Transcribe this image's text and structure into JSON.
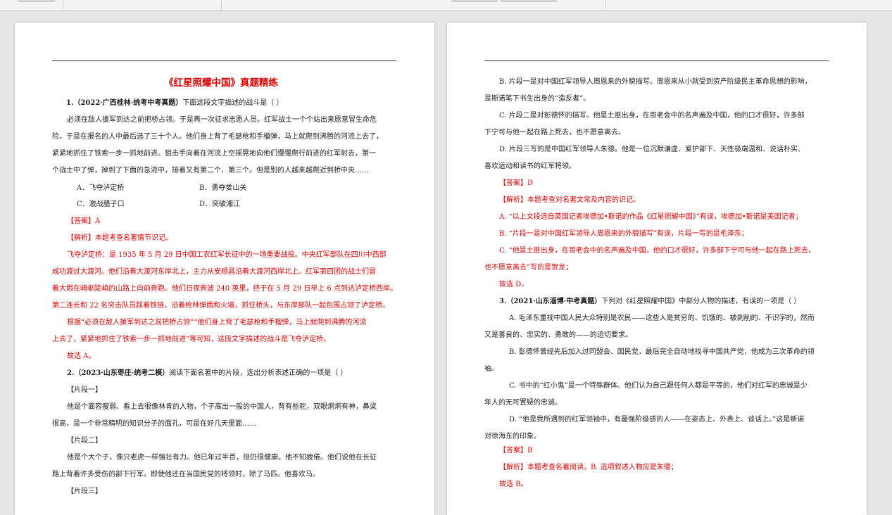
{
  "left_page": {
    "title": "《红星照耀中国》真题精练",
    "q1": {
      "src": "1.（2022·广西桂林·统考中考真题）",
      "stem": "下面这段文字描述的战斗是（        ）",
      "passage": [
        "必须在敌人援军到达之前把桥占领。于是再一次征求志愿人员。红军战士一个个站出来愿意冒生命危",
        "险，于是在报名的人中最后选了三十个人。他们身上背了毛瑟枪和手榴弹，马上就爬到沸腾的河流上去了，",
        "紧紧地抓住了铁索一步一抓地前进。狙击手向着在河流上空摇晃地向他们慢慢爬行前进的红军射去，第一",
        "个战士中了弹，掉到了下面的急流中，接着又有第二个、第三个。但是别的人越来越爬近到桥中央……"
      ],
      "opt_a": "A．飞夺泸定桥",
      "opt_b": "B．勇夺娄山关",
      "opt_c": "C．激战腊子口",
      "opt_d": "D．突破湘江",
      "answer": "【答案】A",
      "analysis": "【解析】本题考查名著情节识记。",
      "detail": [
        "飞夺泸定桥：是 1935 年 5 月 29 日中国工农红军长征中的一场重要战役。中央红军部队在四川中西部",
        "成功渡过大渡河。他们沿着大渡河东岸北上，主力从安顺昌沿着大渡河西岸北上。红军第四团的战士们冒",
        "着大雨在崎岖陡峭的山路上向前奔跑。他们日夜奔波 240 英里，终于在 5 月 29 日早上 6 点到达泸定桥西岸。",
        "第二连长和 22 名突击队员踩着铁链，沿着枪林弹雨和火墙，抓住桥头，与东岸部队一起包围占领了泸定桥。",
        "根据“必须在敌人援军到达之前把桥占领”“他们身上背了毛瑟枪和手榴弹，马上就爬到沸腾的河流",
        "上去了，紧紧地抓住了铁索一步一抓地前进”等可知，这段文字描述的战斗是飞夺泸定桥。",
        "故选 A。"
      ]
    },
    "q2": {
      "src": "2.（2023·山东枣庄·统考二模）",
      "stem": "阅读下面名著中的片段，选出分析表述正确的一项是（        ）",
      "seg1": "【片段一】",
      "seg1_text": [
        "他是个面容瘦弱、看上去很像林肯的人物，个子高出一般的中国人，背有些驼，双眼炯炯有神，鼻梁",
        "很高，是一个非常精明的知识分子的面孔，可是在好几天里面……"
      ],
      "seg2": "【片段二】",
      "seg2_text": [
        "他是个大个子，像只老虎一样强壮有力。他已年过半百，但仍很健康。他不知疲倦。他们说他在长征",
        "路上背着许多受伤的部下行军。即使他还在当国民党的将领时，除了马匹。他喜欢马。"
      ],
      "seg3": "【片段三】"
    }
  },
  "right_page": {
    "opt_b": [
      "B. 片段一是对中国红军领导人周恩来的外貌描写。周恩来从小就受到资产阶级民主革命思想的影响，",
      "是斯诺笔下书生出身的“造反者”。"
    ],
    "opt_c": [
      "C. 片段二是对彭德怀的描写。他是土匪出身，在哥老会中的名声遍及中国，他的口才很好，许多部",
      "下宁可与他一起在路上死去，也不愿意离去。"
    ],
    "opt_d": [
      "D. 片段三写的是中国红军领导人朱德。他是一位沉默谦虚、爱护部下、天性极端温和、说话朴实、",
      "喜欢运动和读书的红军将领。"
    ],
    "answer": "【答案】D",
    "analysis": "【解析】本题考查对名著文常及内容的识记。",
    "detail": [
      "A. “以上文段选自英国记者埃德加•斯诺的作品《红星照耀中国》”有误，埃德加•斯诺是美国记者；",
      "B. “片段一是对中国红军领导人周恩来的外貌描写”有误，片段一写的是毛泽东；",
      "C. “他是土匪出身，在哥老会中的名声遍及中国，他的口才很好，许多部下宁可与他一起在路上死去，",
      "也不愿意离去”写的是贺龙；",
      "故选 D。"
    ],
    "q3": {
      "src": "3.（2021·山东淄博·中考真题）",
      "stem": "下列对《红星照耀中国》中部分人物的描述，有误的一项是（        ）",
      "opt_a": [
        "A. 毛泽东重视中国人民大众特别是农民——这些人是贫穷的、饥饿的、被剥削的、不识字的，然而",
        "又是善良的、忠实的、勇敢的——的迫切要求。"
      ],
      "opt_b": [
        "B. 彭德怀曾经先后加入过同盟会、国民党，最后完全自动地找寻中国共产党，他成为三次革命的领",
        "袖。"
      ],
      "opt_c": [
        "C. 书中的“红小鬼”是一个特殊群体。他们认为自己跟任何人都是平等的，他们对红军的忠诚是少",
        "年人的无可置疑的忠诚。"
      ],
      "opt_d": [
        "D. “他是我所遇到的红军领袖中，有最强阶级感的人——在姿态上、外表上、谈话上。”这是斯诺",
        "对徐海东的印象。"
      ],
      "answer": "【答案】B",
      "analysis": "【解析】本题考查名著阅读。B. 选项叙述人物应是朱德；",
      "final": "故选 B。"
    }
  }
}
